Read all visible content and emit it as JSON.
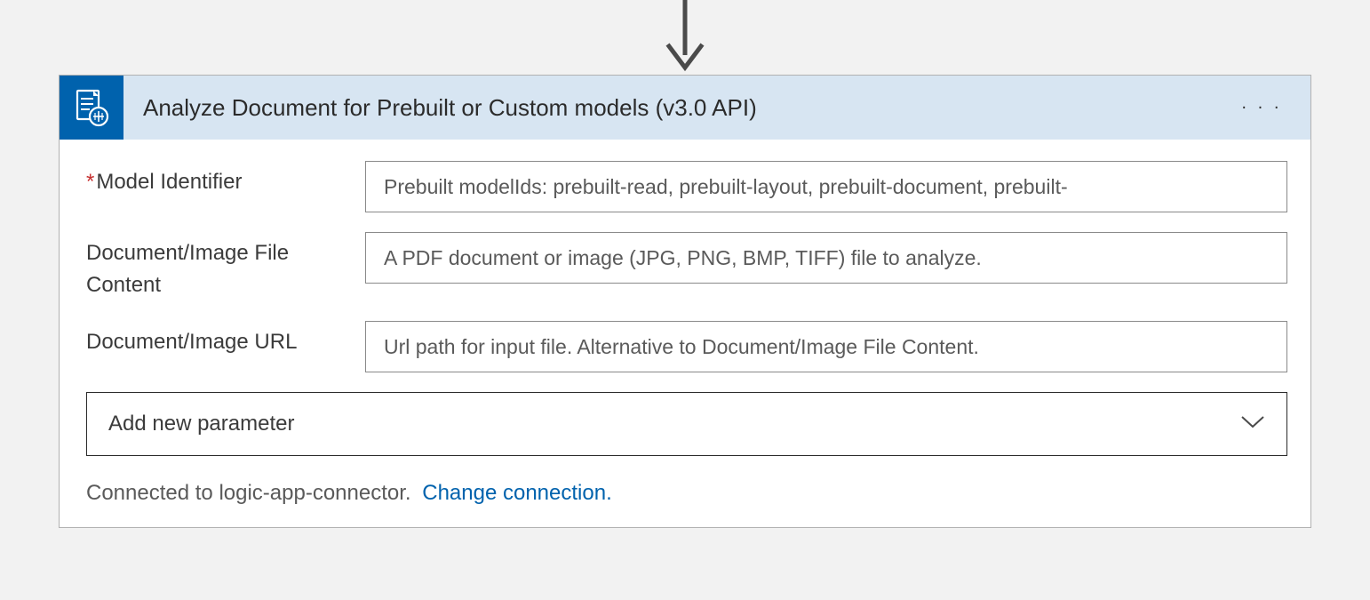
{
  "header": {
    "title": "Analyze Document for Prebuilt or Custom models (v3.0 API)"
  },
  "fields": {
    "model_identifier": {
      "label": "Model Identifier",
      "required": true,
      "placeholder": "Prebuilt modelIds: prebuilt-read, prebuilt-layout, prebuilt-document, prebuilt-"
    },
    "doc_file_content": {
      "label": "Document/Image File Content",
      "placeholder": "A PDF document or image (JPG, PNG, BMP, TIFF) file to analyze."
    },
    "doc_url": {
      "label": "Document/Image URL",
      "placeholder": "Url path for input file. Alternative to Document/Image File Content."
    }
  },
  "add_param": {
    "label": "Add new parameter"
  },
  "footer": {
    "connected_text": "Connected to logic-app-connector.",
    "change_link": "Change connection."
  }
}
